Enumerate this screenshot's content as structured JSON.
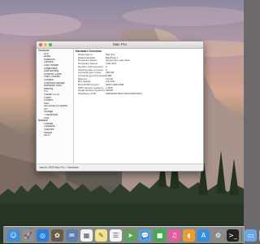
{
  "window": {
    "title": "Mac Pro",
    "statusbar": "Jason's 2009 Mac Pro > Hardware"
  },
  "sidebar": {
    "groups": [
      {
        "label": "Hardware",
        "items": [
          {
            "label": "ATA"
          },
          {
            "label": "Audio"
          },
          {
            "label": "Bluetooth"
          },
          {
            "label": "Camera"
          },
          {
            "label": "Card Reader"
          },
          {
            "label": "Diagnostics"
          },
          {
            "label": "Disc Burning"
          },
          {
            "label": "Ethernet Cards"
          },
          {
            "label": "Fibre Channel"
          },
          {
            "label": "FireWire"
          },
          {
            "label": "Graphics/Displays"
          },
          {
            "label": "Hardware RAID"
          },
          {
            "label": "Memory"
          },
          {
            "label": "PCI"
          },
          {
            "label": "Parallel SCSI"
          },
          {
            "label": "Power"
          },
          {
            "label": "Printers"
          },
          {
            "label": "SAS"
          },
          {
            "label": "SATA/SATA Express"
          },
          {
            "label": "SPI"
          },
          {
            "label": "Storage"
          },
          {
            "label": "Thunderbolt"
          },
          {
            "label": "USB"
          }
        ]
      },
      {
        "label": "Network",
        "items": [
          {
            "label": "Firewall"
          },
          {
            "label": "Locations"
          },
          {
            "label": "Volumes"
          },
          {
            "label": "WWAN"
          },
          {
            "label": "Wi-Fi"
          }
        ]
      }
    ]
  },
  "main": {
    "title": "Hardware Overview:",
    "rows": [
      {
        "label": "Model Name:",
        "value": "Mac Pro"
      },
      {
        "label": "Model Identifier:",
        "value": "MacPro4,1"
      },
      {
        "label": "Processor Name:",
        "value": "Quad-Core Intel Xeon"
      },
      {
        "label": "Processor Speed:",
        "value": "2.66 GHz"
      },
      {
        "label": "Number of Processors:",
        "value": "2"
      },
      {
        "label": "Total Number of Cores:",
        "value": "8"
      },
      {
        "label": "L2 Cache (per Core):",
        "value": "256 KB"
      },
      {
        "label": "L3 Cache (per Processor):",
        "value": "8 MB"
      },
      {
        "label": "Memory:",
        "value": "16 GB"
      },
      {
        "label": "Bus Speed:",
        "value": "4.8 GHz"
      },
      {
        "label": "Boot ROM Version:",
        "value": "MP41.0081.B08"
      },
      {
        "label": "SMC Version (system):",
        "value": "1.39f5"
      },
      {
        "label": "Serial Number (system):",
        "value": "G8930"
      },
      {
        "label": "Hardware UUID:",
        "value": "00000000-0000-1000-8000-0017"
      }
    ]
  },
  "dock": {
    "items": [
      {
        "name": "finder-icon",
        "glyph": "☺",
        "color": "#3b8de0"
      },
      {
        "name": "launchpad-icon",
        "glyph": "🚀",
        "color": "#8a8f99"
      },
      {
        "name": "safari-icon",
        "glyph": "◎",
        "color": "#2a7ee0"
      },
      {
        "name": "photos-icon",
        "glyph": "✿",
        "color": "#6c5a48"
      },
      {
        "name": "mail-icon",
        "glyph": "✉",
        "color": "#5a7fb0"
      },
      {
        "name": "calendar-icon",
        "glyph": "▦",
        "color": "#f2f2f2"
      },
      {
        "name": "notes-icon",
        "glyph": "✎",
        "color": "#f2e28a"
      },
      {
        "name": "reminders-icon",
        "glyph": "☰",
        "color": "#f4f4f4"
      },
      {
        "name": "maps-icon",
        "glyph": "➤",
        "color": "#5fa05a"
      },
      {
        "name": "messages-icon",
        "glyph": "💬",
        "color": "#4aa3f0"
      },
      {
        "name": "facetime-icon",
        "glyph": "■",
        "color": "#3fae4a"
      },
      {
        "name": "itunes-icon",
        "glyph": "♫",
        "color": "#e95aa0"
      },
      {
        "name": "ibooks-icon",
        "glyph": "◖",
        "color": "#f09a2a"
      },
      {
        "name": "app-store-icon",
        "glyph": "A",
        "color": "#2f8fe6"
      },
      {
        "name": "system-preferences-icon",
        "glyph": "⚙",
        "color": "#8a8a8a"
      },
      {
        "name": "terminal-icon",
        "glyph": ">_",
        "color": "#222222"
      },
      {
        "name": "downloads-folder-icon",
        "glyph": "▭",
        "color": "#6aa7e8"
      },
      {
        "name": "trash-icon",
        "glyph": "🗑",
        "color": "#bfc3c8"
      }
    ]
  }
}
